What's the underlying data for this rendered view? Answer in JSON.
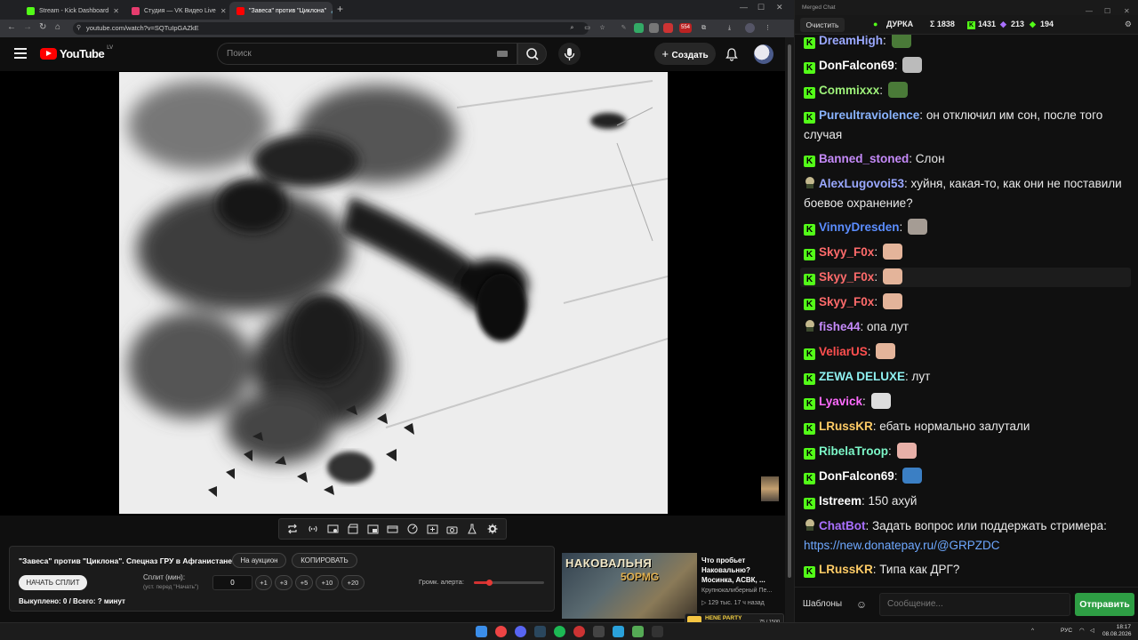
{
  "browser": {
    "tabs": [
      {
        "title": "Stream - Kick Dashboard",
        "color": "#53fc18",
        "active": false
      },
      {
        "title": "Студия — VK Видео Live",
        "color": "#e63c6e",
        "active": false
      },
      {
        "title": "\"Завеса\" против \"Циклона\"",
        "color": "#ff0000",
        "active": true
      }
    ],
    "url": "youtube.com/watch?v=SQTuIpGAZkE",
    "ext_badge": "554"
  },
  "youtube": {
    "logo_text": "YouTube",
    "country": "LV",
    "search_placeholder": "Поиск",
    "create_label": "Создать"
  },
  "split_panel": {
    "video_title": "\"Завеса\" против \"Циклона\". Спецназ ГРУ в Афганистане.",
    "auction_label": "На аукцион",
    "copy_label": "КОПИРОВАТЬ",
    "start_label": "НАЧАТЬ СПЛИТ",
    "split_label": "Сплит (мин):",
    "split_hint": "(уст. перед \"Начать\")",
    "split_value": "0",
    "increments": [
      "+1",
      "+3",
      "+5",
      "+10",
      "+20"
    ],
    "alert_volume_label": "Громк. алерта:",
    "alert_volume": 0.22,
    "status": "Выкуплено: 0 / Всего: ? минут"
  },
  "recommendation": {
    "thumb_text_1": "НАКОВАЛЬНЯ",
    "thumb_text_2": "5ОРМG",
    "title": "Что пробьет Наковальню? Мосинка, АСВК, ...",
    "channel": "Крупнокалиберный Пе...",
    "meta": "129 тыс.  17 ч назад"
  },
  "chat": {
    "window_title": "Merged Chat",
    "clear_label": "Очистить",
    "stats": [
      {
        "icon": "dot",
        "value": "ДУРКА"
      },
      {
        "icon": "sigma",
        "value": "Σ 1838"
      },
      {
        "icon": "kick",
        "value": "1431"
      },
      {
        "icon": "twitch",
        "value": "213"
      },
      {
        "icon": "vk",
        "value": "194"
      }
    ],
    "messages": [
      {
        "platform": "kick",
        "user": "DreamHigh",
        "color": "#9aa8ff",
        "text": "",
        "emote": "#4a7a38"
      },
      {
        "platform": "kick",
        "user": "DonFalcon69",
        "color": "#ffffff",
        "text": "",
        "emote": "#bbbbbb"
      },
      {
        "platform": "kick",
        "user": "Commixxx",
        "color": "#9ef27a",
        "text": "",
        "emote": "#4a7a38"
      },
      {
        "platform": "kick",
        "user": "Pureultraviolence",
        "color": "#8ab4ff",
        "text": "он отключил им сон, после того случая",
        "emote": ""
      },
      {
        "platform": "kick",
        "user": "Banned_stoned",
        "color": "#c58af9",
        "text": "Слон",
        "emote": ""
      },
      {
        "platform": "twitch",
        "user": "AlexLugovoi53",
        "color": "#9aa8ff",
        "text": "хуйня, какая-то, как они не поставили боевое охранение?",
        "emote": ""
      },
      {
        "platform": "kick",
        "user": "VinnyDresden",
        "color": "#5b8dff",
        "text": "",
        "emote": "#a59c94"
      },
      {
        "platform": "kick",
        "user": "Skyy_F0x",
        "color": "#ff6b6b",
        "text": "",
        "emote": "#e4b49a"
      },
      {
        "platform": "kick",
        "user": "Skyy_F0x",
        "color": "#ff6b6b",
        "text": "",
        "emote": "#e4b49a"
      },
      {
        "platform": "kick",
        "user": "Skyy_F0x",
        "color": "#ff6b6b",
        "text": "",
        "emote": "#e4b49a"
      },
      {
        "platform": "twitch",
        "user": "fishe44",
        "color": "#c58af9",
        "text": "опа лут",
        "emote": ""
      },
      {
        "platform": "kick",
        "user": "VeliarUS",
        "color": "#ff4f4f",
        "text": "",
        "emote": "#e4b49a"
      },
      {
        "platform": "kick",
        "user": "ZEWA DELUXE",
        "color": "#8ef0f0",
        "text": "лут",
        "emote": ""
      },
      {
        "platform": "kick",
        "user": "Lyavick",
        "color": "#ff6bff",
        "text": "",
        "emote": "#dddddd"
      },
      {
        "platform": "kick",
        "user": "LRussKR",
        "color": "#ffcc66",
        "text": "ебать нормально залутали",
        "emote": ""
      },
      {
        "platform": "kick",
        "user": "RibelaTroop",
        "color": "#7cf7c8",
        "text": "",
        "emote": "#e8b0a8"
      },
      {
        "platform": "kick",
        "user": "DonFalcon69",
        "color": "#ffffff",
        "text": "",
        "emote": "#3b7fc4"
      },
      {
        "platform": "kick",
        "user": "Istreem",
        "color": "#ffffff",
        "text": "150 ахуй",
        "emote": ""
      },
      {
        "platform": "twitch",
        "user": "ChatBot",
        "color": "#a970ff",
        "text": "Задать вопрос или поддержать стримера:",
        "link": "https://new.donatepay.ru/@GRPZDC",
        "emote": ""
      },
      {
        "platform": "kick",
        "user": "LRussKR",
        "color": "#ffcc66",
        "text": "Типа как ДРГ?",
        "emote": ""
      }
    ],
    "templates_label": "Шаблоны",
    "input_placeholder": "Сообщение...",
    "send_label": "Отправить"
  },
  "media_widget": {
    "title": "HENE PARTY",
    "counter": "75 / 1500",
    "progress": 0.05
  },
  "taskbar": {
    "lang": "РУС",
    "time": "18:17",
    "date": "08.08.2026"
  }
}
